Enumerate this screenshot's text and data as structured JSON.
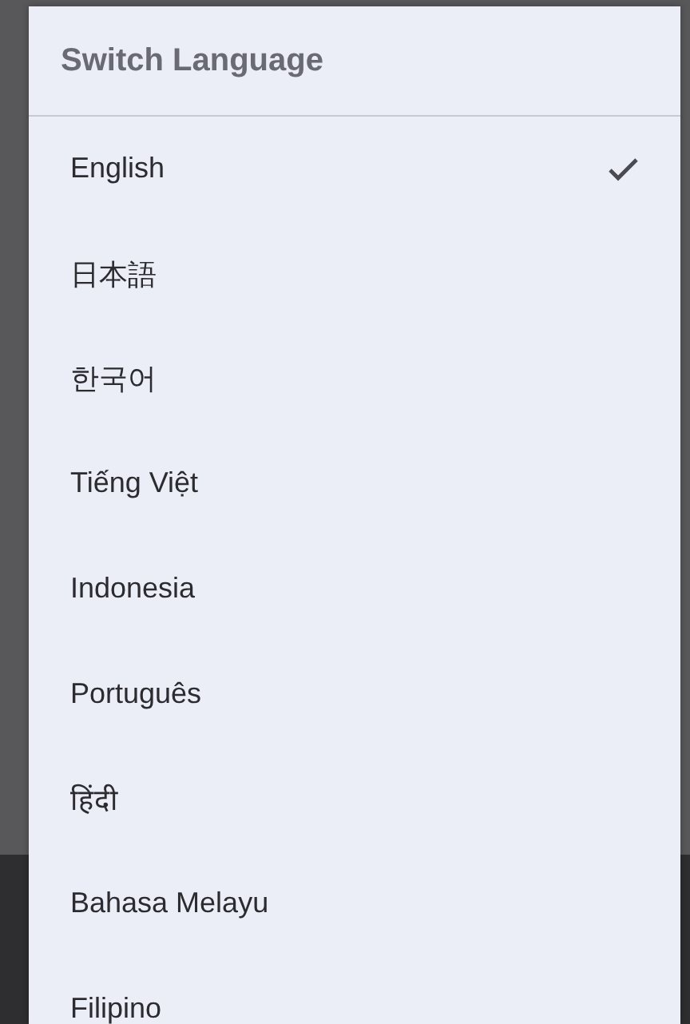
{
  "dialog": {
    "title": "Switch Language",
    "items": [
      {
        "label": "English",
        "selected": true
      },
      {
        "label": "日本語",
        "selected": false
      },
      {
        "label": "한국어",
        "selected": false
      },
      {
        "label": "Tiếng Việt",
        "selected": false
      },
      {
        "label": "Indonesia",
        "selected": false
      },
      {
        "label": "Português",
        "selected": false
      },
      {
        "label": "हिंदी",
        "selected": false
      },
      {
        "label": "Bahasa Melayu",
        "selected": false
      },
      {
        "label": "Filipino",
        "selected": false
      }
    ]
  }
}
